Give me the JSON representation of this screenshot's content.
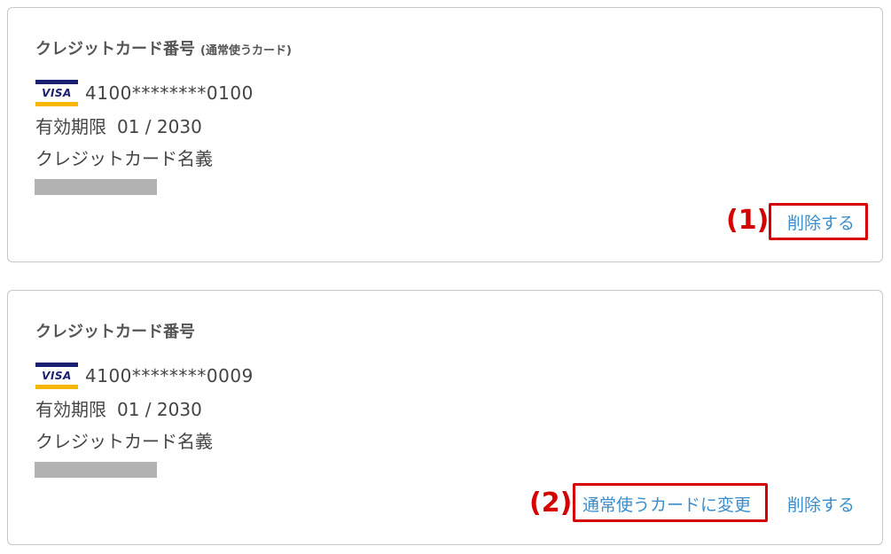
{
  "cards": [
    {
      "title": "クレジットカード番号",
      "default_note": "(通常使うカード)",
      "brand": "VISA",
      "number": "4100********0100",
      "expiry_label": "有効期限",
      "expiry_value": "01 / 2030",
      "holder_label": "クレジットカード名義",
      "delete_label": "削除する",
      "annotation": "(1)"
    },
    {
      "title": "クレジットカード番号",
      "brand": "VISA",
      "number": "4100********0009",
      "expiry_label": "有効期限",
      "expiry_value": "01 / 2030",
      "holder_label": "クレジットカード名義",
      "set_default_label": "通常使うカードに変更",
      "delete_label": "削除する",
      "annotation": "(2)"
    }
  ],
  "colors": {
    "link": "#3a8dc9",
    "annotation_red": "#d40000",
    "redacted": "#b2b2b2"
  }
}
